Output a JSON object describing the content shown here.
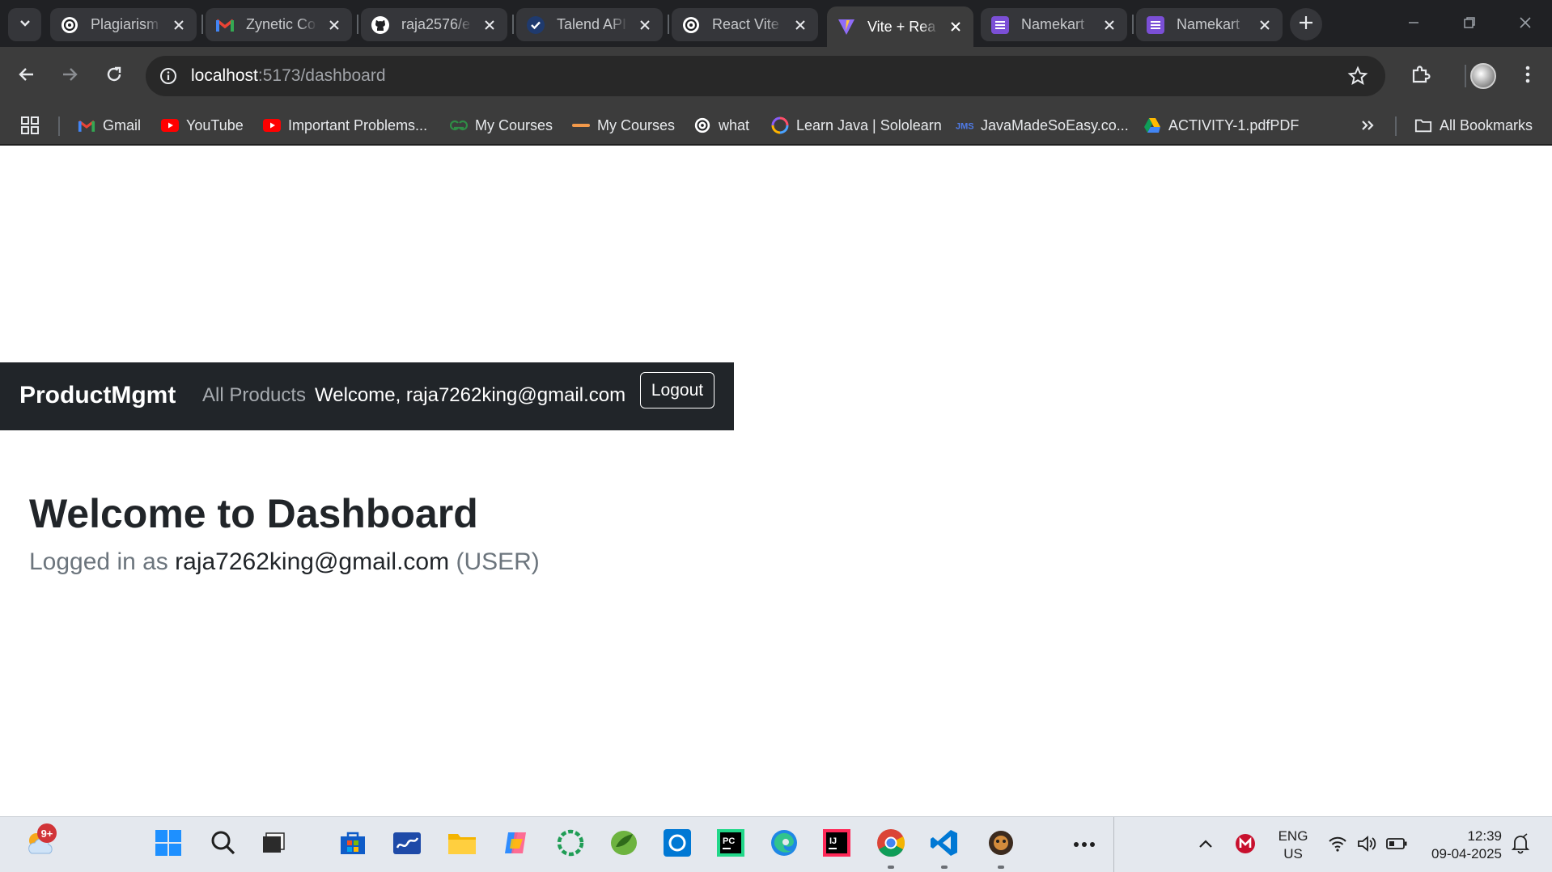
{
  "browser": {
    "tabs": [
      {
        "title": "Plagiarism",
        "icon": "openai-icon",
        "active": false
      },
      {
        "title": "Zynetic Co",
        "icon": "gmail-icon",
        "active": false
      },
      {
        "title": "raja2576/e",
        "icon": "github-icon",
        "active": false
      },
      {
        "title": "Talend API",
        "icon": "check-icon",
        "active": false
      },
      {
        "title": "React Vite",
        "icon": "openai-icon",
        "active": false
      },
      {
        "title": "Vite + Rea",
        "icon": "vite-icon",
        "active": true
      },
      {
        "title": "Namekart",
        "icon": "list-icon",
        "active": false
      },
      {
        "title": "Namekart",
        "icon": "list-icon",
        "active": false
      }
    ],
    "url": {
      "host": "localhost",
      "path": ":5173/dashboard"
    },
    "bookmarks": [
      {
        "label": "Gmail",
        "icon": "gmail-icon"
      },
      {
        "label": "YouTube",
        "icon": "youtube-icon"
      },
      {
        "label": "Important Problems...",
        "icon": "youtube-icon"
      },
      {
        "label": "My Courses",
        "icon": "geeksforgeeks-icon"
      },
      {
        "label": "My Courses",
        "icon": "course-icon"
      },
      {
        "label": "what",
        "icon": "openai-icon"
      },
      {
        "label": "Learn Java | Sololearn",
        "icon": "sololearn-icon"
      },
      {
        "label": "JavaMadeSoEasy.co...",
        "icon": "imse-icon"
      },
      {
        "label": "ACTIVITY-1.pdfPDF",
        "icon": "google-drive-icon"
      }
    ],
    "all_bookmarks_label": "All Bookmarks",
    "accent_color": "#3c3c3c"
  },
  "app": {
    "brand": "ProductMgmt",
    "nav_link": "All Products",
    "welcome_text": "Welcome, raja7262king@gmail.com",
    "logout_label": "Logout",
    "navbar_color": "#212529"
  },
  "dashboard": {
    "title": "Welcome to Dashboard",
    "logged_in_prefix": "Logged in as",
    "email": "raja7262king@gmail.com",
    "role": "(USER)"
  },
  "taskbar": {
    "weather_badge": "9+",
    "apps": [
      "weather-icon",
      "windows-start-icon",
      "search-icon",
      "task-view-icon",
      "microsoft-store-icon",
      "whiteboard-icon",
      "file-explorer-icon",
      "copilot-icon",
      "loader-app-icon",
      "spring-tools-icon",
      "app-square-icon",
      "pycharm-icon",
      "edge-icon",
      "intellij-icon",
      "chrome-icon",
      "vscode-icon",
      "game-icon",
      "more-icon"
    ],
    "lang_line1": "ENG",
    "lang_line2": "US",
    "time": "12:39",
    "date": "09-04-2025"
  }
}
